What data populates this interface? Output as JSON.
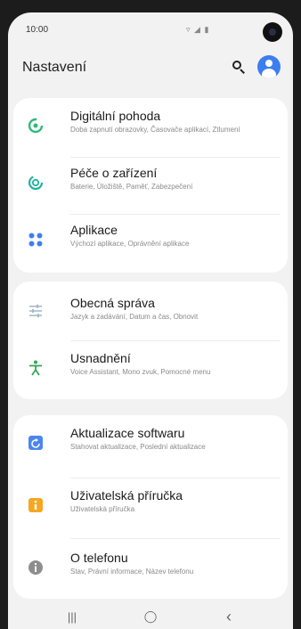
{
  "status": {
    "time": "10:00",
    "indicators": "▿ ◢ ▮"
  },
  "header": {
    "title": "Nastavení"
  },
  "groups": [
    {
      "items": [
        {
          "icon": "digital-wellbeing-icon",
          "title": "Digitální pohoda",
          "subtitle": "Doba zapnutí obrazovky, Časovače aplikací, Ztlumení"
        },
        {
          "icon": "device-care-icon",
          "title": "Péče o zařízení",
          "subtitle": "Baterie, Úložiště, Paměť, Zabezpečení"
        },
        {
          "icon": "apps-icon",
          "title": "Aplikace",
          "subtitle": "Výchozí aplikace, Oprávnění aplikace"
        }
      ]
    },
    {
      "items": [
        {
          "icon": "general-management-icon",
          "title": "Obecná správa",
          "subtitle": "Jazyk a zadávání, Datum a čas, Obnovit"
        },
        {
          "icon": "accessibility-icon",
          "title": "Usnadnění",
          "subtitle": "Voice Assistant, Mono zvuk, Pomocné menu"
        }
      ]
    },
    {
      "items": [
        {
          "icon": "software-update-icon",
          "title": "Aktualizace softwaru",
          "subtitle": "Stahovat aktualizace, Poslední aktualizace"
        },
        {
          "icon": "user-manual-icon",
          "title": "Uživatelská příručka",
          "subtitle": "Uživatelská příručka"
        },
        {
          "icon": "about-phone-icon",
          "title": "O telefonu",
          "subtitle": "Stav, Právní informace, Název telefonu"
        }
      ]
    }
  ],
  "navbar": {
    "recents": "|||",
    "home": "◯",
    "back": "‹"
  },
  "colors": {
    "accent": "#3c7ef0",
    "wellbeing": "#2fb87a",
    "care": "#1fb3a0",
    "apps": "#3d7ff2",
    "general": "#a8b9c8",
    "accessibility": "#33a852",
    "update": "#4b86f0",
    "manual": "#f5a623",
    "about": "#8e8e8e"
  }
}
